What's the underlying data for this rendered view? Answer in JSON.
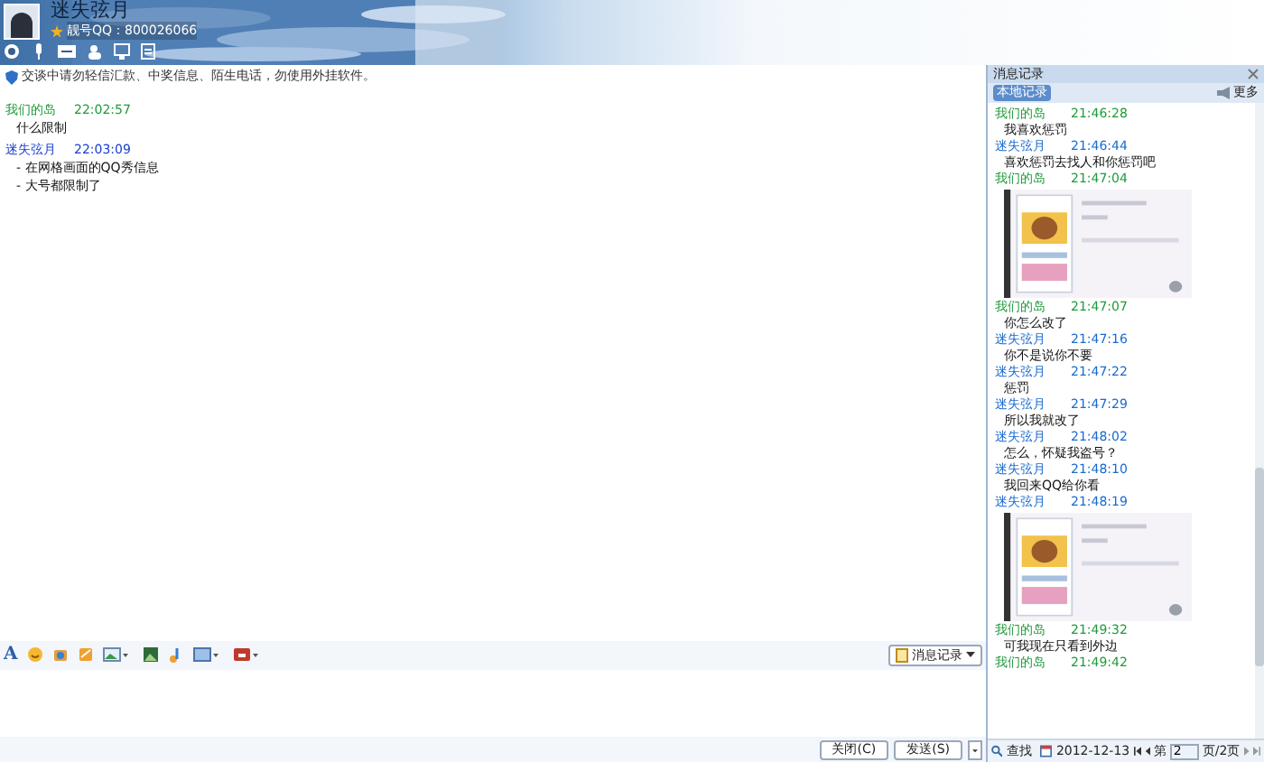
{
  "contact": {
    "name": "迷失弦月",
    "qq": "靓号QQ：800026066"
  },
  "notice": "交谈中请勿轻信汇款、中奖信息、陌生电话，勿使用外挂软件。",
  "messages": [
    {
      "sender": "我们的岛",
      "time": "22:02:57",
      "self": true,
      "lines": [
        "什么限制"
      ]
    },
    {
      "sender": "迷失弦月",
      "time": "22:03:09",
      "self": false,
      "lines": [
        "- 在网格画面的QQ秀信息",
        "- 大号都限制了"
      ]
    }
  ],
  "font_button": "A",
  "record_button": "消息记录",
  "close_button": "关闭(C)",
  "send_button": "发送(S)",
  "history": {
    "title": "消息记录",
    "tab": {
      "label": "本地记录",
      "selected": true
    },
    "more": "更多",
    "entries": [
      {
        "sender": "我们的岛",
        "time": "21:46:28",
        "self": true,
        "kind": "text",
        "text": "我喜欢惩罚"
      },
      {
        "sender": "迷失弦月",
        "time": "21:46:44",
        "self": false,
        "kind": "text",
        "text": "喜欢惩罚去找人和你惩罚吧"
      },
      {
        "sender": "我们的岛",
        "time": "21:47:04",
        "self": true,
        "kind": "picture"
      },
      {
        "sender": "我们的岛",
        "time": "21:47:07",
        "self": true,
        "kind": "text",
        "text": "你怎么改了"
      },
      {
        "sender": "迷失弦月",
        "time": "21:47:16",
        "self": false,
        "kind": "text",
        "text": "你不是说你不要"
      },
      {
        "sender": "迷失弦月",
        "time": "21:47:22",
        "self": false,
        "kind": "text",
        "text": "惩罚"
      },
      {
        "sender": "迷失弦月",
        "time": "21:47:29",
        "self": false,
        "kind": "text",
        "text": "所以我就改了"
      },
      {
        "sender": "迷失弦月",
        "time": "21:48:02",
        "self": false,
        "kind": "text",
        "text": "怎么，怀疑我盗号？"
      },
      {
        "sender": "迷失弦月",
        "time": "21:48:10",
        "self": false,
        "kind": "text",
        "text": "我回来QQ给你看"
      },
      {
        "sender": "迷失弦月",
        "time": "21:48:19",
        "self": false,
        "kind": "picture"
      },
      {
        "sender": "我们的岛",
        "time": "21:49:32",
        "self": true,
        "kind": "text",
        "text": "可我现在只看到外边"
      },
      {
        "sender": "我们的岛",
        "time": "21:49:42",
        "self": true,
        "kind": "text"
      }
    ],
    "find": "查找",
    "date": "2012-12-13",
    "page_prefix": "第",
    "page": "2",
    "page_suffix": "页/2页"
  }
}
